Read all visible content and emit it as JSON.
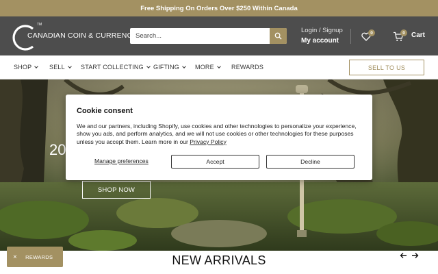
{
  "promo": {
    "text": "Free Shipping On Orders Over $250 Within Canada"
  },
  "header": {
    "logo_text": "CANADIAN COIN & CURRENCY",
    "logo_tm": "TM",
    "search": {
      "placeholder": "Search..."
    },
    "account": {
      "line1": "Login / Signup",
      "line2": "My account"
    },
    "wishlist_count": "0",
    "cart_count": "0",
    "cart_label": "Cart",
    "icons": [
      "search-icon",
      "heart-icon",
      "cart-icon"
    ]
  },
  "nav": {
    "items": [
      {
        "label": "SHOP",
        "has_dropdown": true
      },
      {
        "label": "SELL",
        "has_dropdown": true
      },
      {
        "label": "START COLLECTING",
        "has_dropdown": true
      },
      {
        "label": "GIFTING",
        "has_dropdown": true
      },
      {
        "label": "MORE",
        "has_dropdown": true
      },
      {
        "label": "REWARDS",
        "has_dropdown": false
      }
    ],
    "sell_button": "SELL TO US"
  },
  "hero": {
    "title_partial": "20",
    "cta": "SHOP NOW"
  },
  "cookie": {
    "title": "Cookie consent",
    "body": "We and our partners, including Shopify, use cookies and other technologies to personalize your experience, show you ads, and perform analytics, and we will not use cookies or other technologies for these purposes unless you accept them. Learn more in our ",
    "policy_link": "Privacy Policy",
    "manage": "Manage preferences",
    "accept": "Accept",
    "decline": "Decline"
  },
  "section": {
    "title": "NEW ARRIVALS"
  },
  "rewards_widget": {
    "label": "REWARDS",
    "close": "×"
  },
  "colors": {
    "accent": "#a39162",
    "header_bg": "#4d4d4d"
  }
}
